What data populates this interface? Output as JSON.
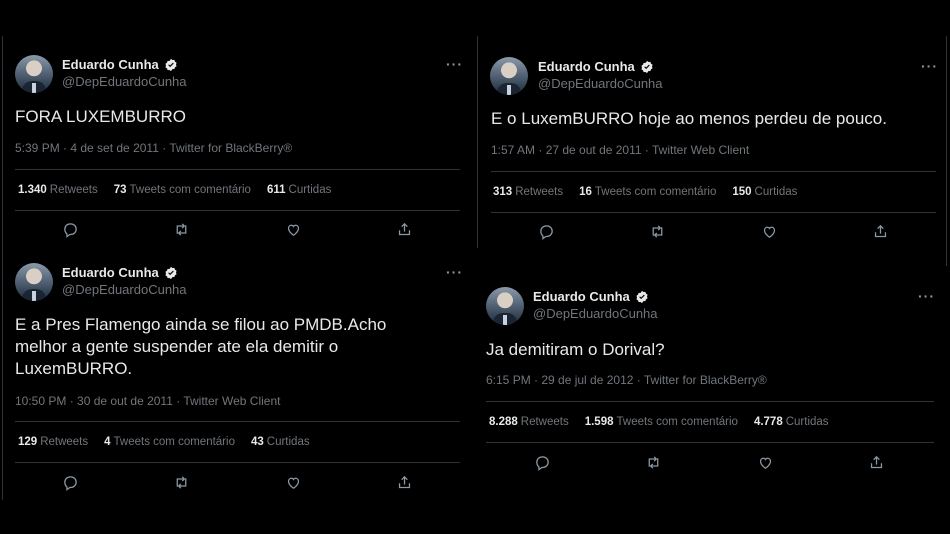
{
  "tweets": [
    {
      "name": "Eduardo Cunha",
      "handle": "@DepEduardoCunha",
      "lines": [
        "FORA LUXEMBURRO"
      ],
      "meta": "5:39 PM · 4 de set de 2011 · Twitter for BlackBerry®",
      "retweets": "1.340",
      "retweets_label": "Retweets",
      "quotes": "73",
      "quotes_label": "Tweets com comentário",
      "likes": "611",
      "likes_label": "Curtidas"
    },
    {
      "name": "Eduardo Cunha",
      "handle": "@DepEduardoCunha",
      "lines": [
        "E o LuxemBURRO hoje ao menos perdeu de pouco."
      ],
      "meta": "1:57 AM · 27 de out de 2011 · Twitter Web Client",
      "retweets": "313",
      "retweets_label": "Retweets",
      "quotes": "16",
      "quotes_label": "Tweets com comentário",
      "likes": "150",
      "likes_label": "Curtidas"
    },
    {
      "name": "Eduardo Cunha",
      "handle": "@DepEduardoCunha",
      "lines": [
        "E a Pres Flamengo ainda se filou ao PMDB.Acho",
        "melhor a gente suspender ate ela demitir o",
        "LuxemBURRO."
      ],
      "meta": "10:50 PM · 30 de out de 2011 · Twitter Web Client",
      "retweets": "129",
      "retweets_label": "Retweets",
      "quotes": "4",
      "quotes_label": "Tweets com comentário",
      "likes": "43",
      "likes_label": "Curtidas"
    },
    {
      "name": "Eduardo Cunha",
      "handle": "@DepEduardoCunha",
      "lines": [
        "Ja demitiram o Dorival?"
      ],
      "meta": "6:15 PM · 29 de jul de 2012 · Twitter for BlackBerry®",
      "retweets": "8.288",
      "retweets_label": "Retweets",
      "quotes": "1.598",
      "quotes_label": "Tweets com comentário",
      "likes": "4.778",
      "likes_label": "Curtidas"
    }
  ],
  "icons": {
    "verified": "verified-badge-icon",
    "more": "more-options-icon",
    "reply": "reply-icon",
    "retweet": "retweet-icon",
    "like": "like-icon",
    "share": "share-icon"
  },
  "colors": {
    "background": "#000000",
    "text": "#e7e9ea",
    "secondary": "#71767b",
    "divider": "#2f3336"
  }
}
